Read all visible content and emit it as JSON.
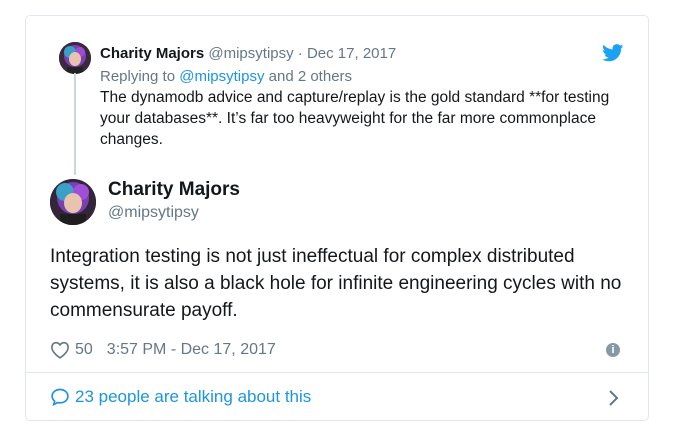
{
  "parent_tweet": {
    "author_name": "Charity Majors",
    "author_handle": "@mipsytipsy",
    "separator": "·",
    "date": "Dec 17, 2017",
    "replying_prefix": "Replying to ",
    "replying_handle": "@mipsytipsy",
    "replying_suffix": " and 2 others",
    "text": "The dynamodb advice and capture/replay is the gold standard **for testing your databases**.  It’s far too heavyweight for the far more commonplace changes."
  },
  "main_tweet": {
    "author_name": "Charity Majors",
    "author_handle": "@mipsytipsy",
    "text": "Integration testing is not just ineffectual for complex distributed systems, it is also a black hole for infinite engineering cycles with no commensurate payoff.",
    "like_count": "50",
    "timestamp": "3:57 PM - Dec 17, 2017"
  },
  "footer": {
    "conversation_label": "23 people are talking about this"
  },
  "icons": {
    "brand": "twitter-bird-icon",
    "like": "heart-icon",
    "info": "info-icon",
    "conversation": "speech-bubble-icon",
    "expand": "chevron-right-icon"
  },
  "colors": {
    "link": "#1b95e0",
    "secondary_text": "#657786",
    "primary_text": "#14171a",
    "border": "#e1e8ed",
    "thread_line": "#ccd6dd"
  }
}
